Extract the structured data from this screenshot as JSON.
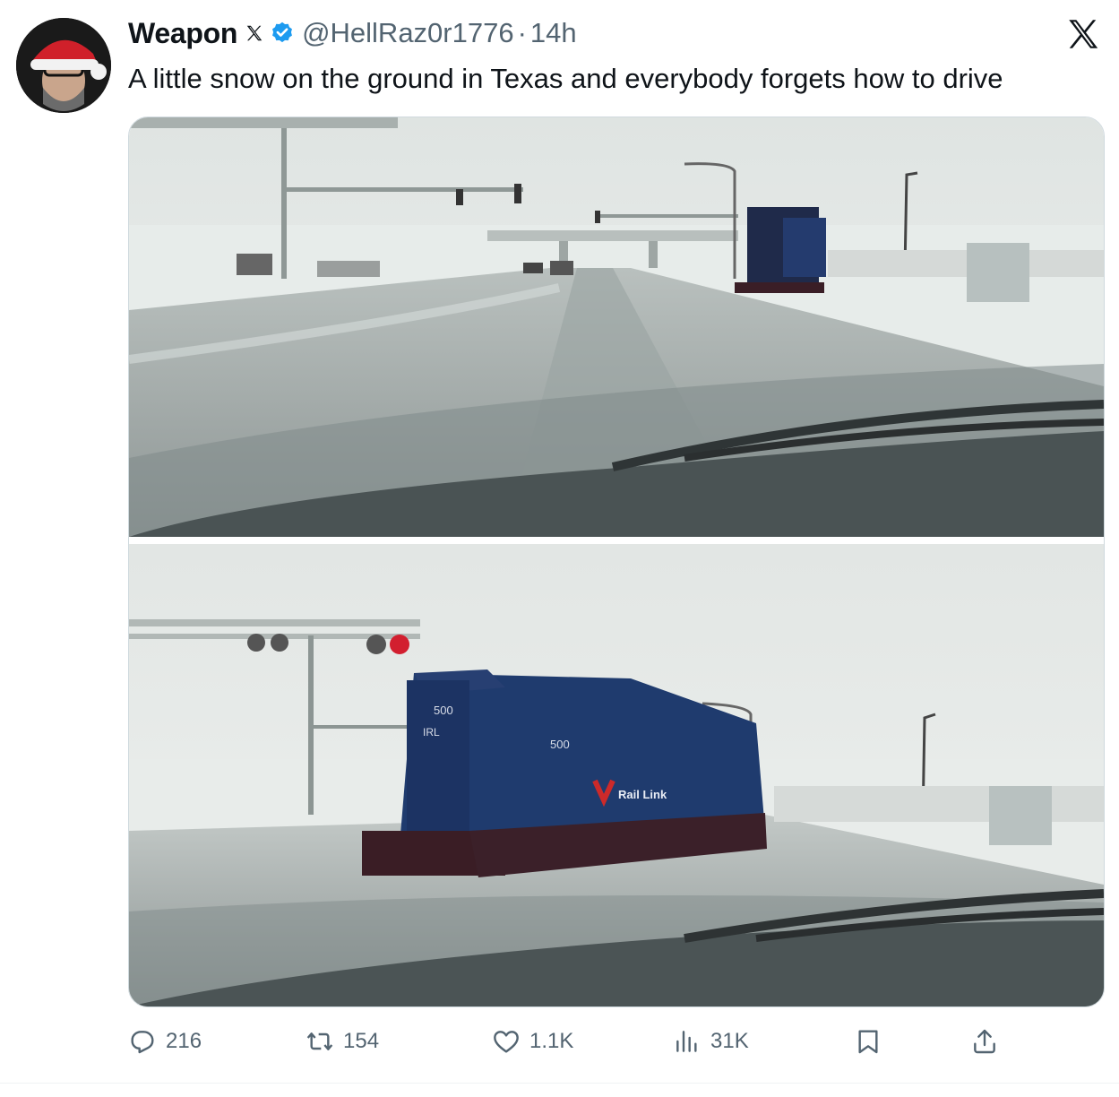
{
  "tweet": {
    "author": {
      "display_name": "Weapon",
      "handle": "@HellRaz0r1776",
      "verified": true,
      "avatar_icon": "santa-hat-avatar-icon"
    },
    "separator": "·",
    "timestamp": "14h",
    "text": "A little snow on the ground in Texas and everybody forgets how to drive",
    "media": {
      "photos": [
        {
          "locomotive_number": ""
        },
        {
          "locomotive_number": "500",
          "reporting_mark": "IRL",
          "logo_text": "Rail Link"
        }
      ]
    },
    "metrics": {
      "replies": "216",
      "reposts": "154",
      "likes": "1.1K",
      "views": "31K"
    },
    "icons": {
      "reply": "reply-icon",
      "repost": "repost-icon",
      "like": "heart-icon",
      "views": "views-icon",
      "bookmark": "bookmark-icon",
      "share": "share-icon",
      "brand": "x-logo-icon"
    }
  },
  "colors": {
    "text_primary": "#0f1419",
    "text_secondary": "#536471",
    "verified_blue": "#1d9bf0",
    "locomotive_blue": "#1f3b6e"
  }
}
